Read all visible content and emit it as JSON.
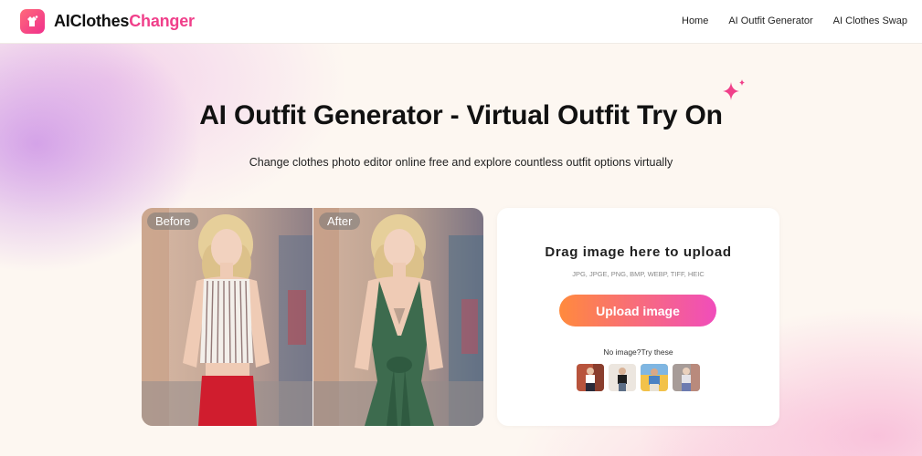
{
  "header": {
    "logo_part1": "AIClothes",
    "logo_part2": "Changer",
    "nav": [
      {
        "label": "Home"
      },
      {
        "label": "AI Outfit Generator"
      },
      {
        "label": "AI Clothes Swap"
      }
    ]
  },
  "hero": {
    "title": "AI Outfit Generator - Virtual Outfit Try On",
    "subtitle": "Change clothes photo editor online free and explore countless outfit options virtually"
  },
  "compare": {
    "before_label": "Before",
    "after_label": "After"
  },
  "upload": {
    "title": "Drag image here to upload",
    "formats": "JPG, JPGE, PNG, BMP, WEBP, TIFF, HEIC",
    "button_label": "Upload image",
    "no_image_text": "No image?Try these",
    "sample_count_icons": [
      "sample-photo-1",
      "sample-photo-2",
      "sample-photo-3",
      "sample-photo-4"
    ]
  },
  "colors": {
    "brand_pink": "#f03f8a",
    "button_start": "#ff8a3d",
    "button_end": "#f04dbb"
  }
}
